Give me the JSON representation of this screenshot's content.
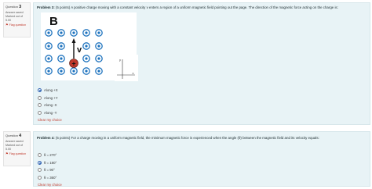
{
  "q3": {
    "number": "3",
    "label": "Question",
    "status": "Answer saved",
    "marked": "Marked out of",
    "marks": "5.00",
    "flag": "Flag question",
    "text_bold": "Problem 3:",
    "text": " (5 points) A positive charge moving with a constant velocity v enters a region of a uniform magnetic field pointing out the page. The direction of the magnetic force acting on the charge is:",
    "figure": {
      "field_label": "B",
      "velocity_label": "v",
      "axis_x": "x",
      "axis_y": "y"
    },
    "options": [
      "Along +X",
      "Along +Y",
      "Along -X",
      "Along -Y"
    ],
    "selected_index": 0,
    "clear": "Clear my choice"
  },
  "q4": {
    "number": "4",
    "label": "Question",
    "status": "Answer saved",
    "marked": "Marked out of",
    "marks": "5.00",
    "flag": "Flag question",
    "text_bold": "Problem 4:",
    "text": " (5 points) For a charge moving in a uniform magnetic field, the minimum magnetic force is experienced when the angle (θ) between the magnetic field and its velocity equals:",
    "options": [
      "θ = 270°",
      "θ = 180°",
      "θ = 90°",
      "θ = 360°"
    ],
    "selected_index": 1,
    "clear": "Clear my choice"
  },
  "colors": {
    "content_bg": "#e8f3f6",
    "dot": "#1e73be",
    "charge": "#c0392b",
    "flag": "#c0392b"
  }
}
